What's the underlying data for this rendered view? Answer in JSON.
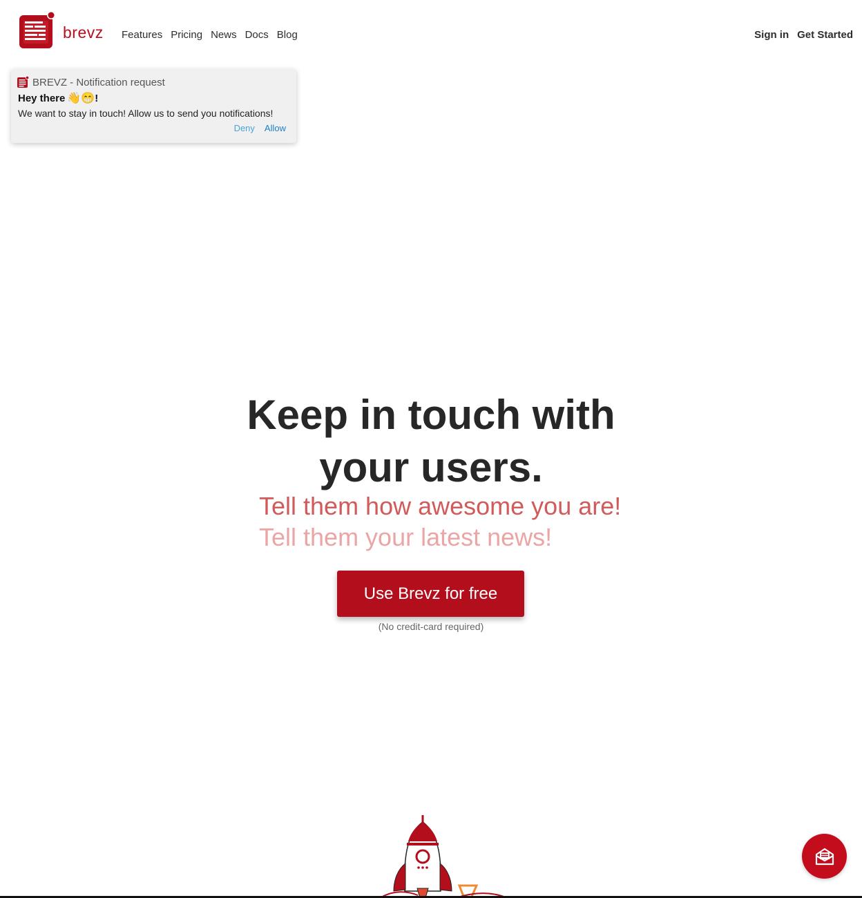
{
  "header": {
    "brand": "brevz",
    "nav": [
      "Features",
      "Pricing",
      "News",
      "Docs",
      "Blog"
    ],
    "sign_in": "Sign in",
    "get_started": "Get Started"
  },
  "notification": {
    "title": "BREVZ - Notification request",
    "greeting": "Hey there",
    "greeting_emoji": "👋😁",
    "greeting_end": "!",
    "message": "We want to stay in touch! Allow us to send you notifications!",
    "deny": "Deny",
    "allow": "Allow"
  },
  "hero": {
    "title_line1": "Keep in touch with",
    "title_line2": "your users.",
    "tagline1": "Tell them how awesome you are!",
    "tagline2": "Tell them your latest news!",
    "cta": "Use Brevz for free",
    "note": "(No credit-card required)"
  },
  "colors": {
    "brand_red": "#b20e1c",
    "link_blue": "#1a80cc"
  },
  "icons": {
    "logo": "newspaper-logo-icon",
    "chat": "mail-icon",
    "illustration": "rocket-icon"
  }
}
